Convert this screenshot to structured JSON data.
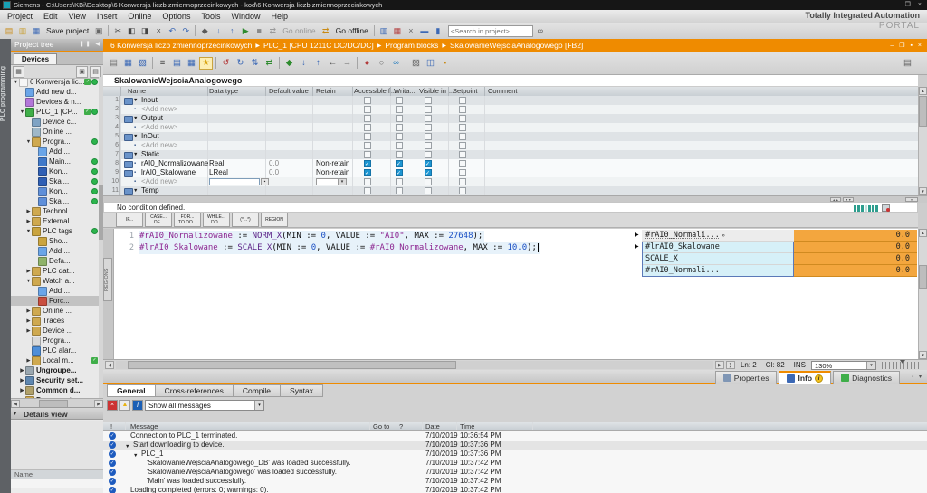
{
  "colors": {
    "accent": "#ef8b00",
    "green": "#2db44d",
    "cbblue": "#1e96d2",
    "watchorange": "#f3a63e",
    "selcyan": "#d6f0f8",
    "msgblue": "#1d5bbf"
  },
  "window": {
    "title": "Siemens  -  C:\\Users\\KBi\\Desktop\\6 Konwersja liczb zmiennoprzecinkowych - kod\\6 Konwersja liczb zmiennoprzecinkowych",
    "controls": "– ❒ ×"
  },
  "brand": {
    "line1": "Totally Integrated Automation",
    "line2": "PORTAL"
  },
  "menu": [
    "Project",
    "Edit",
    "View",
    "Insert",
    "Online",
    "Options",
    "Tools",
    "Window",
    "Help"
  ],
  "main_toolbar": [
    {
      "t": "icon",
      "n": "new-project-icon",
      "g": "▤",
      "c": "#c98a14"
    },
    {
      "t": "icon",
      "n": "open-project-icon",
      "g": "▥",
      "c": "#c9a23c"
    },
    {
      "t": "icon",
      "n": "save-project-icon",
      "g": "▦",
      "c": "#3b68b5"
    },
    {
      "t": "label",
      "n": "save-project-label",
      "g": "Save project"
    },
    {
      "t": "icon",
      "n": "print-icon",
      "g": "▣",
      "c": "#666666"
    },
    {
      "t": "sep"
    },
    {
      "t": "icon",
      "n": "cut-icon",
      "g": "✂",
      "c": "#444444"
    },
    {
      "t": "icon",
      "n": "copy-icon",
      "g": "◧",
      "c": "#444444"
    },
    {
      "t": "icon",
      "n": "paste-icon",
      "g": "◨",
      "c": "#444444"
    },
    {
      "t": "icon",
      "n": "delete-icon",
      "g": "×",
      "c": "#444444"
    },
    {
      "t": "icon",
      "n": "undo-icon",
      "g": "↶",
      "c": "#3b68b5"
    },
    {
      "t": "icon",
      "n": "redo-icon",
      "g": "↷",
      "c": "#3b68b5"
    },
    {
      "t": "sep"
    },
    {
      "t": "icon",
      "n": "compile-icon",
      "g": "◆",
      "c": "#5a5a5a"
    },
    {
      "t": "icon",
      "n": "download-to-device-icon",
      "g": "↓",
      "c": "#3b68b5"
    },
    {
      "t": "icon",
      "n": "upload-from-device-icon",
      "g": "↑",
      "c": "#3b68b5"
    },
    {
      "t": "icon",
      "n": "start-cpu-icon",
      "g": "▶",
      "c": "#2e8b2e"
    },
    {
      "t": "icon",
      "n": "stop-cpu-icon",
      "g": "■",
      "c": "#8a8a8a"
    },
    {
      "t": "icon",
      "n": "go-online-icon",
      "g": "⇄",
      "c": "#9a9a9a"
    },
    {
      "t": "label",
      "n": "go-online-label",
      "g": "Go online",
      "dim": true
    },
    {
      "t": "icon",
      "n": "go-offline-icon",
      "g": "⇄",
      "c": "#c98a14"
    },
    {
      "t": "label",
      "n": "go-offline-label",
      "g": "Go offline"
    },
    {
      "t": "sep"
    },
    {
      "t": "icon",
      "n": "accessible-devices-icon",
      "g": "▥",
      "c": "#3b68b5"
    },
    {
      "t": "icon",
      "n": "start-simulation-icon",
      "g": "▦",
      "c": "#b23b3b"
    },
    {
      "t": "icon",
      "n": "close-windows-icon",
      "g": "×",
      "c": "#666666"
    },
    {
      "t": "icon",
      "n": "horizontal-layout-icon",
      "g": "▬",
      "c": "#3b68b5"
    },
    {
      "t": "icon",
      "n": "vertical-layout-icon",
      "g": "▮",
      "c": "#3b68b5"
    },
    {
      "t": "search",
      "n": "search-input",
      "g": "<Search in project>"
    },
    {
      "t": "icon",
      "n": "project-library-icon",
      "g": "∞",
      "c": "#555555"
    }
  ],
  "breadcrumb": [
    "6 Konwersja liczb zmiennoprzecinkowych",
    "PLC_1 [CPU 1211C DC/DC/DC]",
    "Program blocks",
    "SkalowanieWejsciaAnalogowego [FB2]"
  ],
  "breadcrumb_controls": "– ❒ ▪ ×",
  "rail": {
    "label": "PLC programming"
  },
  "project_tree": {
    "header": "Project tree",
    "tab": "Devices",
    "items": [
      {
        "label": "6 Konwersja lic...",
        "depth": 0,
        "arrow": "down",
        "icon": "project",
        "check": true,
        "dot": true
      },
      {
        "label": "Add new d...",
        "depth": 1,
        "arrow": "",
        "icon": "add"
      },
      {
        "label": "Devices & n...",
        "depth": 1,
        "arrow": "",
        "icon": "network"
      },
      {
        "label": "PLC_1 [CP...",
        "depth": 1,
        "arrow": "down",
        "icon": "plc",
        "check": true,
        "dot": true
      },
      {
        "label": "Device c...",
        "depth": 2,
        "arrow": "",
        "icon": "device"
      },
      {
        "label": "Online ...",
        "depth": 2,
        "arrow": "",
        "icon": "online"
      },
      {
        "label": "Progra...",
        "depth": 2,
        "arrow": "down",
        "icon": "folder",
        "dot": true
      },
      {
        "label": "Add ...",
        "depth": 3,
        "arrow": "",
        "icon": "add"
      },
      {
        "label": "Main...",
        "depth": 3,
        "arrow": "",
        "icon": "block",
        "dot": true
      },
      {
        "label": "Kon...",
        "depth": 3,
        "arrow": "",
        "icon": "fb",
        "dot": true
      },
      {
        "label": "Skal...",
        "depth": 3,
        "arrow": "",
        "icon": "fb",
        "dot": true
      },
      {
        "label": "Kon...",
        "depth": 3,
        "arrow": "",
        "icon": "db",
        "dot": true
      },
      {
        "label": "Skal...",
        "depth": 3,
        "arrow": "",
        "icon": "db",
        "dot": true
      },
      {
        "label": "Technol...",
        "depth": 2,
        "arrow": "right",
        "icon": "folder"
      },
      {
        "label": "External...",
        "depth": 2,
        "arrow": "right",
        "icon": "folder"
      },
      {
        "label": "PLC tags",
        "depth": 2,
        "arrow": "down",
        "icon": "tags",
        "dot": true
      },
      {
        "label": "Sho...",
        "depth": 3,
        "arrow": "",
        "icon": "tags"
      },
      {
        "label": "Add ...",
        "depth": 3,
        "arrow": "",
        "icon": "add"
      },
      {
        "label": "Defa...",
        "depth": 3,
        "arrow": "",
        "icon": "table"
      },
      {
        "label": "PLC dat...",
        "depth": 2,
        "arrow": "right",
        "icon": "folder"
      },
      {
        "label": "Watch a...",
        "depth": 2,
        "arrow": "down",
        "icon": "folder"
      },
      {
        "label": "Add ...",
        "depth": 3,
        "arrow": "",
        "icon": "add"
      },
      {
        "label": "Forc...",
        "depth": 3,
        "arrow": "",
        "icon": "force",
        "selected": true
      },
      {
        "label": "Online ...",
        "depth": 2,
        "arrow": "right",
        "icon": "folder"
      },
      {
        "label": "Traces",
        "depth": 2,
        "arrow": "right",
        "icon": "folder"
      },
      {
        "label": "Device ...",
        "depth": 2,
        "arrow": "right",
        "icon": "folder"
      },
      {
        "label": "Progra...",
        "depth": 2,
        "arrow": "",
        "icon": "info"
      },
      {
        "label": "PLC alar...",
        "depth": 2,
        "arrow": "",
        "icon": "alarm"
      },
      {
        "label": "Local m...",
        "depth": 2,
        "arrow": "right",
        "icon": "folder",
        "check": true
      },
      {
        "label": "Ungroupe...",
        "depth": 1,
        "arrow": "right",
        "icon": "group",
        "bold": true
      },
      {
        "label": "Security set...",
        "depth": 1,
        "arrow": "right",
        "icon": "security",
        "bold": true
      },
      {
        "label": "Common d...",
        "depth": 1,
        "arrow": "right",
        "icon": "common",
        "bold": true
      },
      {
        "label": "Documenta...",
        "depth": 1,
        "arrow": "right",
        "icon": "folder",
        "bold": true
      }
    ]
  },
  "details_view": {
    "header": "Details view",
    "name_col": "Name"
  },
  "editor": {
    "block_title": "SkalowanieWejsciaAnalogowego",
    "toolbar": [
      {
        "t": "icon",
        "n": "print-preview-icon",
        "g": "▤",
        "c": "#777777"
      },
      {
        "t": "icon",
        "n": "insert-line-icon",
        "g": "▦",
        "c": "#3b68b5"
      },
      {
        "t": "icon",
        "n": "add-line-icon",
        "g": "▧",
        "c": "#3b68b5"
      },
      {
        "t": "sep"
      },
      {
        "t": "icon",
        "n": "expand-all-icon",
        "g": "≡",
        "c": "#444444"
      },
      {
        "t": "icon",
        "n": "collapse-all-icon",
        "g": "▤",
        "c": "#3b68b5"
      },
      {
        "t": "icon",
        "n": "keep-actual-values-icon",
        "g": "▦",
        "c": "#3b68b5"
      },
      {
        "t": "icon",
        "n": "snapshot-camera-icon",
        "g": "★",
        "c": "#d9a514",
        "hot": true
      },
      {
        "t": "sep"
      },
      {
        "t": "icon",
        "n": "reset-start-values-icon",
        "g": "↺",
        "c": "#b23b3b"
      },
      {
        "t": "icon",
        "n": "copy-snapshot-icon",
        "g": "↻",
        "c": "#3b68b5"
      },
      {
        "t": "icon",
        "n": "load-start-values-icon",
        "g": "⇅",
        "c": "#3b68b5"
      },
      {
        "t": "icon",
        "n": "refresh-icon",
        "g": "⇄",
        "c": "#2e8b2e"
      },
      {
        "t": "sep"
      },
      {
        "t": "icon",
        "n": "compile-block-icon",
        "g": "◆",
        "c": "#2e8b2e"
      },
      {
        "t": "icon",
        "n": "download-block-icon",
        "g": "↓",
        "c": "#3b68b5"
      },
      {
        "t": "icon",
        "n": "upload-block-icon",
        "g": "↑",
        "c": "#3b68b5"
      },
      {
        "t": "icon",
        "n": "go-to-previous-icon",
        "g": "←",
        "c": "#444444"
      },
      {
        "t": "icon",
        "n": "go-to-next-icon",
        "g": "→",
        "c": "#444444"
      },
      {
        "t": "sep"
      },
      {
        "t": "icon",
        "n": "set-breakpoint-icon",
        "g": "●",
        "c": "#b23b3b"
      },
      {
        "t": "icon",
        "n": "remove-breakpoint-icon",
        "g": "○",
        "c": "#666666"
      },
      {
        "t": "icon",
        "n": "monitor-icon",
        "g": "∞",
        "c": "#2a7fbf"
      },
      {
        "t": "sep"
      },
      {
        "t": "icon",
        "n": "absolute-symbolic-icon",
        "g": "▨",
        "c": "#666666"
      },
      {
        "t": "icon",
        "n": "split-view-icon",
        "g": "◫",
        "c": "#3b68b5"
      },
      {
        "t": "icon",
        "n": "lock-icon",
        "g": "▪",
        "c": "#c98a14"
      }
    ],
    "table": {
      "headers": [
        "Name",
        "Data type",
        "Default value",
        "Retain",
        "Accessible f...",
        "Writa...",
        "Visible in ...",
        "Setpoint",
        "Comment"
      ],
      "rows": [
        {
          "num": "1",
          "kind": "section",
          "name": "Input"
        },
        {
          "num": "2",
          "kind": "addnew",
          "name": "<Add new>"
        },
        {
          "num": "3",
          "kind": "section",
          "name": "Output"
        },
        {
          "num": "4",
          "kind": "addnew",
          "name": "<Add new>"
        },
        {
          "num": "5",
          "kind": "section",
          "name": "InOut"
        },
        {
          "num": "6",
          "kind": "addnew",
          "name": "<Add new>"
        },
        {
          "num": "7",
          "kind": "section",
          "name": "Static"
        },
        {
          "num": "8",
          "kind": "var",
          "name": "rAI0_Normalizowane",
          "data_type": "Real",
          "default_value": "0.0",
          "retain": "Non-retain",
          "accessible": true,
          "writable": true,
          "visible": true,
          "setpoint": false
        },
        {
          "num": "9",
          "kind": "var",
          "name": "lrAI0_Skalowane",
          "data_type": "LReal",
          "default_value": "0.0",
          "retain": "Non-retain",
          "accessible": true,
          "writable": true,
          "visible": true,
          "setpoint": false
        },
        {
          "num": "10",
          "kind": "addnew-edit",
          "name": "<Add new>"
        },
        {
          "num": "11",
          "kind": "section",
          "name": "Temp"
        }
      ]
    },
    "condition_text": "No condition defined.",
    "snippets": [
      [
        "IF..."
      ],
      [
        "CASE...",
        "OF..."
      ],
      [
        "FOR...",
        "TO DO..."
      ],
      [
        "WHILE...",
        "DO..."
      ],
      [
        "(*...*)"
      ],
      [
        "REGION"
      ]
    ],
    "regions_tab": "REGIONS",
    "code": {
      "lines": [
        {
          "n": "1",
          "caret": false,
          "tokens": [
            [
              "tv",
              "#rAI0_Normalizowane"
            ],
            [
              "tp",
              " := "
            ],
            [
              "tf",
              "NORM_X"
            ],
            [
              "tp",
              "(MIN := "
            ],
            [
              "tn",
              "0"
            ],
            [
              "tp",
              ", VALUE := "
            ],
            [
              "ts",
              "\"AI0\""
            ],
            [
              "tp",
              ", MAX := "
            ],
            [
              "tn",
              "27648"
            ],
            [
              "tp",
              ");"
            ]
          ]
        },
        {
          "n": "2",
          "caret": true,
          "tokens": [
            [
              "tv",
              "#lrAI0_Skalowane"
            ],
            [
              "tp",
              " := "
            ],
            [
              "tf",
              "SCALE_X"
            ],
            [
              "tp",
              "(MIN := "
            ],
            [
              "tn",
              "0"
            ],
            [
              "tp",
              ", VALUE := "
            ],
            [
              "tv",
              "#rAI0_Normalizowane"
            ],
            [
              "tp",
              ", MAX := "
            ],
            [
              "tn",
              "10.0"
            ],
            [
              "tp",
              ");"
            ]
          ]
        }
      ]
    },
    "watch": {
      "rows": [
        {
          "name": "#rAI0_Normali...",
          "value": "0.0",
          "marker": true,
          "icon": true,
          "selected": false
        },
        {
          "name": "#lrAI0_Skalowane",
          "value": "0.0",
          "marker": true,
          "icon": false,
          "selected": true
        },
        {
          "name": "SCALE_X",
          "value": "0.0",
          "marker": false,
          "icon": false,
          "selected": true
        },
        {
          "name": "#rAI0_Normali...",
          "value": "0.0",
          "marker": false,
          "icon": false,
          "selected": true
        }
      ]
    },
    "status": {
      "line": "Ln: 2",
      "col": "Cl: 82",
      "mode": "INS",
      "zoom": "130%"
    }
  },
  "inspector": {
    "right_tabs": [
      {
        "label": "Properties",
        "active": false,
        "badge": false,
        "icon": "prop"
      },
      {
        "label": "Info",
        "active": true,
        "badge": true,
        "icon": "info"
      },
      {
        "label": "Diagnostics",
        "active": false,
        "badge": false,
        "icon": "diag"
      }
    ],
    "tabs": [
      "General",
      "Cross-references",
      "Compile",
      "Syntax"
    ],
    "active_tab": "General",
    "filter_value": "Show all messages",
    "columns": [
      "!",
      "Message",
      "Go to",
      "?",
      "Date",
      "Time"
    ],
    "messages": [
      {
        "text": "Connection to PLC_1 terminated.",
        "indent": 0,
        "arrow": "",
        "date": "7/10/2019",
        "time": "10:36:54 PM",
        "highlight": false
      },
      {
        "text": "Start downloading to device.",
        "indent": 0,
        "arrow": "down",
        "date": "7/10/2019",
        "time": "10:37:36 PM",
        "highlight": true
      },
      {
        "text": "PLC_1",
        "indent": 1,
        "arrow": "down",
        "date": "7/10/2019",
        "time": "10:37:36 PM",
        "highlight": false
      },
      {
        "text": "'SkalowanieWejsciaAnalogowego_DB' was loaded successfully.",
        "indent": 2,
        "arrow": "",
        "date": "7/10/2019",
        "time": "10:37:42 PM",
        "highlight": false
      },
      {
        "text": "'SkalowanieWejsciaAnalogowego' was loaded successfully.",
        "indent": 2,
        "arrow": "",
        "date": "7/10/2019",
        "time": "10:37:42 PM",
        "highlight": false
      },
      {
        "text": "'Main' was loaded successfully.",
        "indent": 2,
        "arrow": "",
        "date": "7/10/2019",
        "time": "10:37:42 PM",
        "highlight": false
      },
      {
        "text": "Loading completed (errors: 0; warnings: 0).",
        "indent": 0,
        "arrow": "",
        "date": "7/10/2019",
        "time": "10:37:42 PM",
        "highlight": false
      }
    ]
  }
}
